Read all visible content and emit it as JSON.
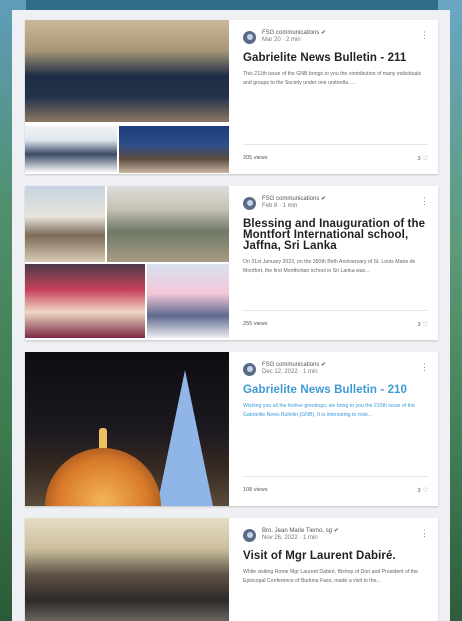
{
  "posts": [
    {
      "author": "FSG communications ✔",
      "date": "Mar 20 · 2 min",
      "title": "Gabrielite News Bulletin - 211",
      "title_link": false,
      "excerpt": "This 211th issue of the GNB brings to you the contribution of many individuals and groups to the Society under one umbrella. ...",
      "excerpt_link": false,
      "views": "205 views",
      "likes": "3"
    },
    {
      "author": "FSG communications ✔",
      "date": "Feb 8 · 1 min",
      "title": "Blessing and Inauguration of the Montfort International school, Jaffna, Sri Lanka",
      "title_link": false,
      "excerpt": "On 31st January 2023, on the 350th Birth Anniversary of St. Louis Marie de Montfort, the first Montfortian school in Sri Lanka was...",
      "excerpt_link": false,
      "views": "255 views",
      "likes": "3"
    },
    {
      "author": "FSG communications ✔",
      "date": "Dec 12, 2022 · 1 min",
      "title": "Gabrielite News Bulletin - 210",
      "title_link": true,
      "excerpt": "Wishing you all the festive greetings, we bring to you the 210th issue of the Gabrielite News Bulletin (GNB). It is interesting to note...",
      "excerpt_link": true,
      "views": "108 views",
      "likes": "3"
    },
    {
      "author": "Bro. Jean Marie Tiemo, sg ✔",
      "date": "Nov 26, 2022 · 1 min",
      "title": "Visit of Mgr Laurent Dabiré.",
      "title_link": false,
      "excerpt": "While visiting Rome Mgr Laurent Dabiré, Bishop of Dori and President of the Episcopal Conference of Burkina Faso, made a visit to the...",
      "excerpt_link": false,
      "views": "",
      "likes": ""
    }
  ]
}
